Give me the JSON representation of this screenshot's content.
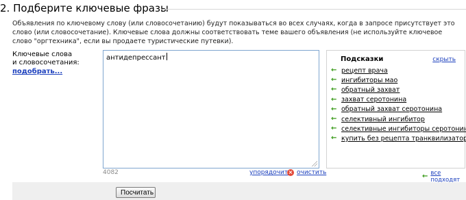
{
  "section": {
    "title": "2. Подберите ключевые фразы",
    "description": "Объявления по ключевому слову (или словосочетанию) будут показываться во всех случаях, когда в запросе присутствует это слово (или словосочетание). Ключевые слова должны соответствовать теме вашего объявления (не используйте ключевое слово \"оргтехника\", если вы продаете туристические путевки)."
  },
  "keywords": {
    "label_line1": "Ключевые слова",
    "label_line2": "и словосочетания:",
    "pick_link": "подобрать...",
    "value": "антидепрессант",
    "counter": "4082",
    "order_link": "упорядочить",
    "clear_link": "очистить"
  },
  "hints": {
    "title": "Подсказки",
    "hide_link": "скрыть",
    "items": [
      "рецепт врача",
      "ингибиторы мао",
      "обратный захват",
      "захват серотонина",
      "обратный захват серотонина",
      "селективный ингибитор",
      "селективные ингибиторы серотонина",
      "купить без рецепта транквилизаторы"
    ],
    "all_fit_link": "все подходят"
  },
  "actions": {
    "calculate_label": "Посчитать"
  },
  "colors": {
    "link": "#1b3fbd",
    "hint_arrow": "#3a9a1a",
    "textarea_border": "#7fa5cf",
    "clear_icon": "#e24a3a"
  }
}
